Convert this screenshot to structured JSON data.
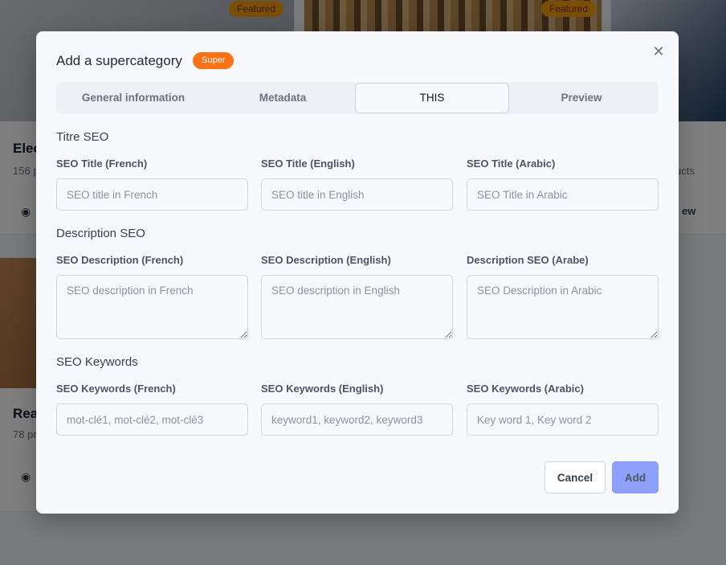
{
  "background": {
    "cards": [
      {
        "title": "Elec",
        "subtitle": "156 p",
        "badge": "Featured"
      },
      {
        "title": "",
        "subtitle": "",
        "badge": "Featured"
      },
      {
        "title": "",
        "subtitle": "ucts",
        "badge": "",
        "view_label": "ew"
      },
      {
        "title": "Rea",
        "subtitle": "78 pr",
        "badge": ""
      }
    ]
  },
  "modal": {
    "title": "Add a supercategory",
    "badge": "Super",
    "close_icon": "close-icon",
    "tabs": [
      {
        "label": "General information",
        "active": false
      },
      {
        "label": "Metadata",
        "active": false
      },
      {
        "label": "THIS",
        "active": true
      },
      {
        "label": "Preview",
        "active": false
      }
    ],
    "sections": {
      "title_seo": {
        "heading": "Titre SEO",
        "fields": [
          {
            "label": "SEO Title (French)",
            "placeholder": "SEO title in French",
            "value": ""
          },
          {
            "label": "SEO Title (English)",
            "placeholder": "SEO title in English",
            "value": ""
          },
          {
            "label": "SEO Title (Arabic)",
            "placeholder": "SEO Title in Arabic",
            "value": ""
          }
        ]
      },
      "description_seo": {
        "heading": "Description SEO",
        "fields": [
          {
            "label": "SEO Description (French)",
            "placeholder": "SEO description in French",
            "value": ""
          },
          {
            "label": "SEO Description (English)",
            "placeholder": "SEO description in English",
            "value": ""
          },
          {
            "label": "Description SEO (Arabe)",
            "placeholder": "SEO Description in Arabic",
            "value": ""
          }
        ]
      },
      "keywords_seo": {
        "heading": "SEO Keywords",
        "fields": [
          {
            "label": "SEO Keywords (French)",
            "placeholder": "mot-clé1, mot-clé2, mot-clé3",
            "value": ""
          },
          {
            "label": "SEO Keywords (English)",
            "placeholder": "keyword1, keyword2, keyword3",
            "value": ""
          },
          {
            "label": "SEO Keywords (Arabic)",
            "placeholder": "Key word 1, Key word 2",
            "value": ""
          }
        ]
      }
    },
    "buttons": {
      "cancel": "Cancel",
      "add": "Add"
    },
    "colors": {
      "accent": "#f97316",
      "primary": "#8fa0fb"
    }
  }
}
